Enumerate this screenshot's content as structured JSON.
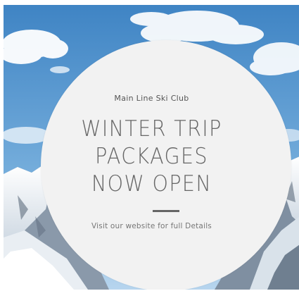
{
  "poster": {
    "club_name": "Main Line Ski Club",
    "headline_lines": [
      "WINTER TRIP",
      "PACKAGES",
      "NOW OPEN"
    ],
    "details": "Visit our website for full Details"
  },
  "colors": {
    "sky": "#4f8fc8",
    "circle": "#f2f2f2",
    "text": "#666666"
  }
}
